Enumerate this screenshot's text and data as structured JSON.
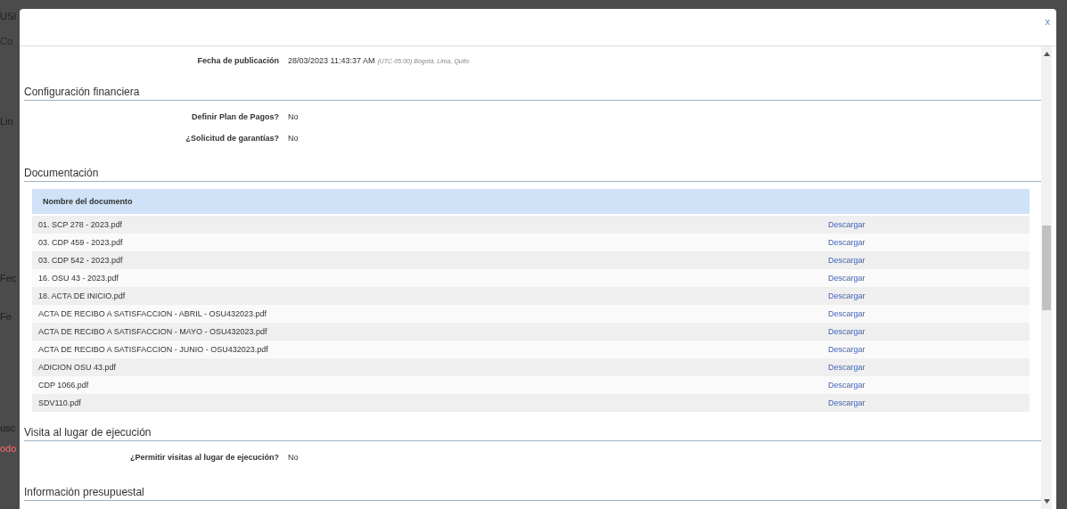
{
  "background_fragments": [
    {
      "text": "USI",
      "kind": "plain"
    },
    {
      "text": "Co",
      "kind": "italic"
    },
    {
      "text": "Lin",
      "kind": "plain"
    },
    {
      "text": "Fec",
      "kind": "plain"
    },
    {
      "text": "Fe",
      "kind": "plain"
    },
    {
      "text": "usc",
      "kind": "plain"
    },
    {
      "text": "odo",
      "kind": "alert"
    }
  ],
  "modal": {
    "close": "x",
    "top_fields": [
      {
        "label": "Fecha de publicación",
        "value": "28/03/2023 11:43:37 AM",
        "note": "(UTC-05:00) Bogotá, Lima, Quito"
      }
    ],
    "sections": [
      {
        "kind": "fields",
        "title": "Configuración financiera",
        "fields": [
          {
            "label": "Definir Plan de Pagos?",
            "value": "No"
          },
          {
            "label": "¿Solicitud de garantías?",
            "value": "No"
          }
        ]
      },
      {
        "kind": "table",
        "title": "Documentación",
        "columns": [
          "Nombre del documento"
        ],
        "rows": [
          {
            "name": "01. SCP 278 - 2023.pdf",
            "action": "Descargar"
          },
          {
            "name": "03. CDP 459 - 2023.pdf",
            "action": "Descargar"
          },
          {
            "name": "03. CDP 542 - 2023.pdf",
            "action": "Descargar"
          },
          {
            "name": "16. OSU 43 - 2023.pdf",
            "action": "Descargar"
          },
          {
            "name": "18. ACTA DE INICIO.pdf",
            "action": "Descargar"
          },
          {
            "name": "ACTA DE RECIBO A SATISFACCION - ABRIL - OSU432023.pdf",
            "action": "Descargar"
          },
          {
            "name": "ACTA DE RECIBO A SATISFACCION - MAYO - OSU432023.pdf",
            "action": "Descargar"
          },
          {
            "name": "ACTA DE RECIBO A SATISFACCION - JUNIO - OSU432023.pdf",
            "action": "Descargar"
          },
          {
            "name": "ADICION OSU 43.pdf",
            "action": "Descargar"
          },
          {
            "name": "CDP 1066.pdf",
            "action": "Descargar"
          },
          {
            "name": "SDV110.pdf",
            "action": "Descargar"
          }
        ]
      },
      {
        "kind": "fields",
        "title": "Visita al lugar de ejecución",
        "fields": [
          {
            "label": "¿Permitir visitas al lugar de ejecución?",
            "value": "No"
          }
        ]
      },
      {
        "kind": "heading",
        "title": "Información presupuestal"
      }
    ]
  }
}
